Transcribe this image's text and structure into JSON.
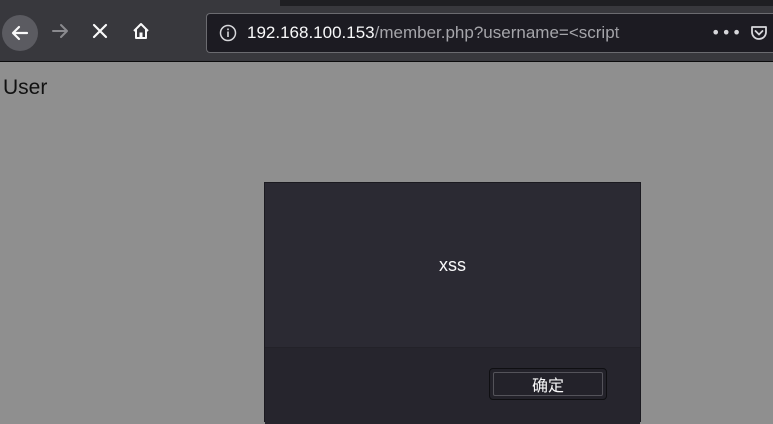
{
  "toolbar": {
    "back_icon": "arrow-left-icon",
    "forward_icon": "arrow-right-icon",
    "stop_icon": "close-x-icon",
    "home_icon": "home-icon"
  },
  "urlbar": {
    "host": "192.168.100.153",
    "path": "/member.php?username=<script",
    "info_icon": "info-circle-icon",
    "page_actions": "•••",
    "pocket_icon": "pocket-icon"
  },
  "page": {
    "text": "User"
  },
  "dialog": {
    "message": "xss",
    "ok_label": "确定"
  },
  "colors": {
    "toolbar_bg": "#38383d",
    "page_bg": "#8f8f8f",
    "dialog_bg": "#2b2a33"
  }
}
